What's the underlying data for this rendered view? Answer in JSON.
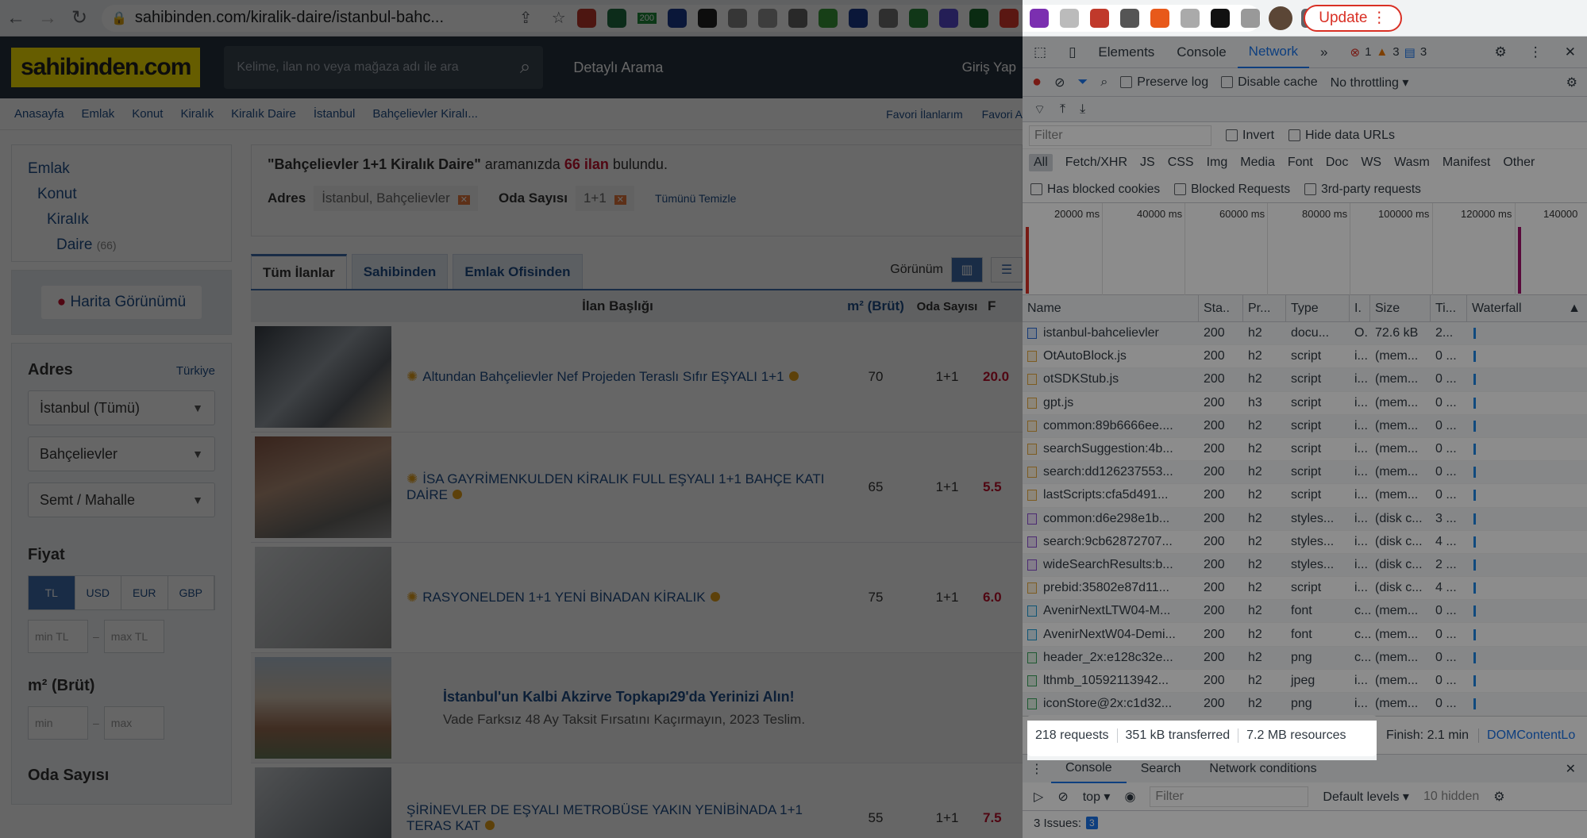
{
  "browser": {
    "url": "sahibinden.com/kiralik-daire/istanbul-bahc...",
    "update_label": "Update",
    "ext_badge": "200"
  },
  "site": {
    "logo": "sahibinden.com",
    "search_placeholder": "Kelime, ilan no veya mağaza adı ile ara",
    "detayli": "Detaylı Arama",
    "giris": "Giriş Yap",
    "breadcrumbs": [
      "Anasayfa",
      "Emlak",
      "Konut",
      "Kiralık",
      "Kiralık Daire",
      "İstanbul",
      "Bahçelievler Kiralı..."
    ],
    "fav1": "Favori İlanlarım",
    "fav2": "Favori A",
    "cat": {
      "l1": "Emlak",
      "l2": "Konut",
      "l3": "Kiralık",
      "l4": "Daire",
      "count": "(66)"
    },
    "map_button": "Harita Görünümü",
    "adres": {
      "title": "Adres",
      "country": "Türkiye",
      "il": "İstanbul (Tümü)",
      "ilce": "Bahçelievler",
      "semt": "Semt / Mahalle"
    },
    "fiyat": {
      "title": "Fiyat",
      "currencies": [
        "TL",
        "USD",
        "EUR",
        "GBP"
      ],
      "min": "min TL",
      "max": "max TL"
    },
    "m2": {
      "title": "m² (Brüt)",
      "min": "min",
      "max": "max"
    },
    "oda": {
      "title": "Oda Sayısı"
    },
    "summary": {
      "q": "\"Bahçelievler 1+1 Kiralık Daire\"",
      "mid": "aramanızda",
      "count": "66 ilan",
      "end": "bulundu."
    },
    "chips": {
      "adres_label": "Adres",
      "adres_val": "İstanbul, Bahçelievler",
      "oda_label": "Oda Sayısı",
      "oda_val": "1+1",
      "clear": "Tümünü Temizle"
    },
    "tabs": [
      "Tüm İlanlar",
      "Sahibinden",
      "Emlak Ofisinden"
    ],
    "view_label": "Görünüm",
    "thead": {
      "title": "İlan Başlığı",
      "m2": "m² (Brüt)",
      "oda": "Oda Sayısı",
      "f": "F"
    },
    "rows": [
      {
        "title": "Altundan Bahçelievler Nef Projeden Teraslı Sıfır EŞYALI 1+1",
        "m2": "70",
        "oda": "1+1",
        "fy": "20.0"
      },
      {
        "title": "İSA GAYRİMENKULDEN KİRALIK FULL EŞYALI 1+1 BAHÇE KATI DAİRE",
        "m2": "65",
        "oda": "1+1",
        "fy": "5.5"
      },
      {
        "title": "RASYONELDEN 1+1 YENİ BİNADAN KİRALIK",
        "m2": "75",
        "oda": "1+1",
        "fy": "6.0"
      },
      {
        "title": "ŞİRİNEVLER DE EŞYALI METROBÜSE YAKIN YENİBİNADA 1+1 TERAS KAT",
        "m2": "55",
        "oda": "1+1",
        "fy": "7.5"
      }
    ],
    "ad": {
      "title": "İstanbul'un Kalbi Akzirve Topkapı29'da Yerinizi Alın!",
      "sub": "Vade Farksız 48 Ay Taksit Fırsatını Kaçırmayın, 2023 Teslim."
    }
  },
  "devtools": {
    "tabs": [
      "Elements",
      "Console",
      "Network"
    ],
    "badges": {
      "errors": "1",
      "warnings": "3",
      "messages": "3"
    },
    "preserve_log": "Preserve log",
    "disable_cache": "Disable cache",
    "throttling": "No throttling",
    "filter_placeholder": "Filter",
    "invert": "Invert",
    "hide_data": "Hide data URLs",
    "types": [
      "All",
      "Fetch/XHR",
      "JS",
      "CSS",
      "Img",
      "Media",
      "Font",
      "Doc",
      "WS",
      "Wasm",
      "Manifest",
      "Other"
    ],
    "blocked_cookies": "Has blocked cookies",
    "blocked_requests": "Blocked Requests",
    "third_party": "3rd-party requests",
    "ticks": [
      "20000 ms",
      "40000 ms",
      "60000 ms",
      "80000 ms",
      "100000 ms",
      "120000 ms",
      "140000"
    ],
    "columns": [
      "Name",
      "Sta..",
      "Pr...",
      "Type",
      "I.",
      "Size",
      "Ti...",
      "Waterfall"
    ],
    "requests": [
      {
        "name": "istanbul-bahcelievler",
        "status": "200",
        "proto": "h2",
        "type": "docu...",
        "init": "O.",
        "size": "72.6 kB",
        "time": "2...",
        "icon": "doc"
      },
      {
        "name": "OtAutoBlock.js",
        "status": "200",
        "proto": "h2",
        "type": "script",
        "init": "i...",
        "size": "(mem...",
        "time": "0 ...",
        "icon": "js"
      },
      {
        "name": "otSDKStub.js",
        "status": "200",
        "proto": "h2",
        "type": "script",
        "init": "i...",
        "size": "(mem...",
        "time": "0 ...",
        "icon": "js"
      },
      {
        "name": "gpt.js",
        "status": "200",
        "proto": "h3",
        "type": "script",
        "init": "i...",
        "size": "(mem...",
        "time": "0 ...",
        "icon": "js"
      },
      {
        "name": "common:89b6666ee....",
        "status": "200",
        "proto": "h2",
        "type": "script",
        "init": "i...",
        "size": "(mem...",
        "time": "0 ...",
        "icon": "js"
      },
      {
        "name": "searchSuggestion:4b...",
        "status": "200",
        "proto": "h2",
        "type": "script",
        "init": "i...",
        "size": "(mem...",
        "time": "0 ...",
        "icon": "js"
      },
      {
        "name": "search:dd126237553...",
        "status": "200",
        "proto": "h2",
        "type": "script",
        "init": "i...",
        "size": "(mem...",
        "time": "0 ...",
        "icon": "js"
      },
      {
        "name": "lastScripts:cfa5d491...",
        "status": "200",
        "proto": "h2",
        "type": "script",
        "init": "i...",
        "size": "(mem...",
        "time": "0 ...",
        "icon": "js"
      },
      {
        "name": "common:d6e298e1b...",
        "status": "200",
        "proto": "h2",
        "type": "styles...",
        "init": "i...",
        "size": "(disk c...",
        "time": "3 ...",
        "icon": "css"
      },
      {
        "name": "search:9cb62872707...",
        "status": "200",
        "proto": "h2",
        "type": "styles...",
        "init": "i...",
        "size": "(disk c...",
        "time": "4 ...",
        "icon": "css"
      },
      {
        "name": "wideSearchResults:b...",
        "status": "200",
        "proto": "h2",
        "type": "styles...",
        "init": "i...",
        "size": "(disk c...",
        "time": "2 ...",
        "icon": "css"
      },
      {
        "name": "prebid:35802e87d11...",
        "status": "200",
        "proto": "h2",
        "type": "script",
        "init": "i...",
        "size": "(disk c...",
        "time": "4 ...",
        "icon": "js"
      },
      {
        "name": "AvenirNextLTW04-M...",
        "status": "200",
        "proto": "h2",
        "type": "font",
        "init": "c...",
        "size": "(mem...",
        "time": "0 ...",
        "icon": "font"
      },
      {
        "name": "AvenirNextW04-Demi...",
        "status": "200",
        "proto": "h2",
        "type": "font",
        "init": "c...",
        "size": "(mem...",
        "time": "0 ...",
        "icon": "font"
      },
      {
        "name": "header_2x:e128c32e...",
        "status": "200",
        "proto": "h2",
        "type": "png",
        "init": "c...",
        "size": "(mem...",
        "time": "0 ...",
        "icon": "img"
      },
      {
        "name": "lthmb_10592113942...",
        "status": "200",
        "proto": "h2",
        "type": "jpeg",
        "init": "i...",
        "size": "(mem...",
        "time": "0 ...",
        "icon": "img"
      },
      {
        "name": "iconStore@2x:c1d32...",
        "status": "200",
        "proto": "h2",
        "type": "png",
        "init": "i...",
        "size": "(mem...",
        "time": "0 ...",
        "icon": "img"
      }
    ],
    "summary": {
      "requests": "218 requests",
      "transferred": "351 kB transferred",
      "resources": "7.2 MB resources",
      "finish": "Finish: 2.1 min",
      "dom": "DOMContentLo"
    },
    "drawer_tabs": [
      "Console",
      "Search",
      "Network conditions"
    ],
    "console": {
      "context": "top",
      "filter": "Filter",
      "levels": "Default levels",
      "hidden": "10 hidden"
    },
    "issues": {
      "label": "3 Issues:",
      "count": "3"
    }
  },
  "colors": {
    "site_header": "#26323f",
    "logo_bg": "#ffe800",
    "link": "#1f4f8b",
    "accent": "#1a73e8",
    "price": "#c8102e"
  }
}
